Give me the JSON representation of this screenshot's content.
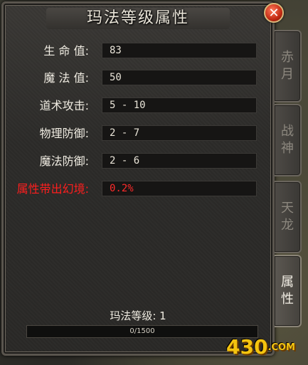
{
  "panel": {
    "title": "玛法等级属性",
    "close_label": "✕"
  },
  "attributes": [
    {
      "label": "生 命 值:",
      "value": "83",
      "highlight": false
    },
    {
      "label": "魔 法 值:",
      "value": "50",
      "highlight": false
    },
    {
      "label": "道术攻击:",
      "value": "5 - 10",
      "highlight": false
    },
    {
      "label": "物理防御:",
      "value": "2 - 7",
      "highlight": false
    },
    {
      "label": "魔法防御:",
      "value": "2 - 6",
      "highlight": false
    },
    {
      "label": "属性带出幻境:",
      "value": "0.2%",
      "highlight": true
    }
  ],
  "level": {
    "label": "玛法等级: 1",
    "exp_text": "0/1500",
    "exp_fraction": 0
  },
  "tabs": [
    {
      "label_line1": "赤",
      "label_line2": "月",
      "active": false
    },
    {
      "label_line1": "战",
      "label_line2": "神",
      "active": false
    },
    {
      "label_line1": "天",
      "label_line2": "龙",
      "active": false
    },
    {
      "label_line1": "属",
      "label_line2": "性",
      "active": true
    }
  ],
  "logo": {
    "main": "430",
    "suffix": ".COM"
  },
  "colors": {
    "highlight_red": "#ff1e1e",
    "logo_gold": "#f4c40f"
  }
}
